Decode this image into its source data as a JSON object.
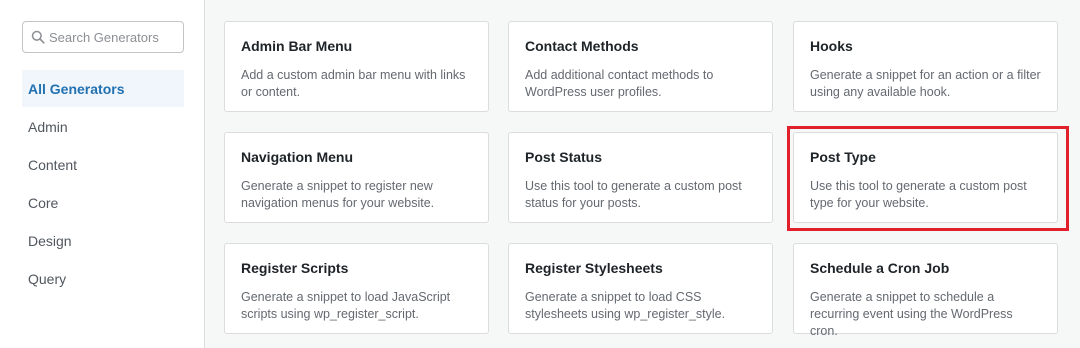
{
  "search": {
    "placeholder": "Search Generators",
    "value": ""
  },
  "categories": [
    {
      "label": "All Generators",
      "active": true
    },
    {
      "label": "Admin",
      "active": false
    },
    {
      "label": "Content",
      "active": false
    },
    {
      "label": "Core",
      "active": false
    },
    {
      "label": "Design",
      "active": false
    },
    {
      "label": "Query",
      "active": false
    }
  ],
  "generators": [
    {
      "title": "Admin Bar Menu",
      "description": "Add a custom admin bar menu with links or content."
    },
    {
      "title": "Contact Methods",
      "description": "Add additional contact methods to WordPress user profiles."
    },
    {
      "title": "Hooks",
      "description": "Generate a snippet for an action or a filter using any available hook."
    },
    {
      "title": "Navigation Menu",
      "description": "Generate a snippet to register new navigation menus for your website."
    },
    {
      "title": "Post Status",
      "description": "Use this tool to generate a custom post status for your posts."
    },
    {
      "title": "Post Type",
      "description": "Use this tool to generate a custom post type for your website."
    },
    {
      "title": "Register Scripts",
      "description": "Generate a snippet to load JavaScript scripts using wp_register_script."
    },
    {
      "title": "Register Stylesheets",
      "description": "Generate a snippet to load CSS stylesheets using wp_register_style."
    },
    {
      "title": "Schedule a Cron Job",
      "description": "Generate a snippet to schedule a recurring event using the WordPress cron."
    }
  ],
  "colors": {
    "accent": "#2271b1",
    "active_bg": "#f0f6fc",
    "highlight": "#e0212c",
    "card_border": "#dcdcde"
  },
  "icons": {
    "search": "search-icon"
  }
}
